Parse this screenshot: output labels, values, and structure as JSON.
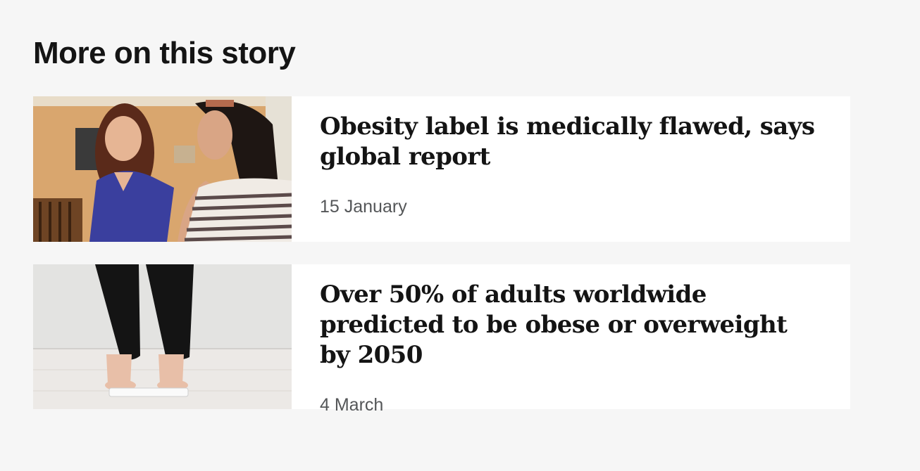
{
  "section": {
    "title": "More on this story"
  },
  "stories": [
    {
      "headline": "Obesity label is medically flawed, says global report",
      "date": "15 January",
      "image_icon": "photo-nurse-patient"
    },
    {
      "headline": "Over 50% of adults worldwide predicted to be obese or overweight by 2050",
      "date": "4 March",
      "image_icon": "photo-bathroom-scale"
    }
  ]
}
